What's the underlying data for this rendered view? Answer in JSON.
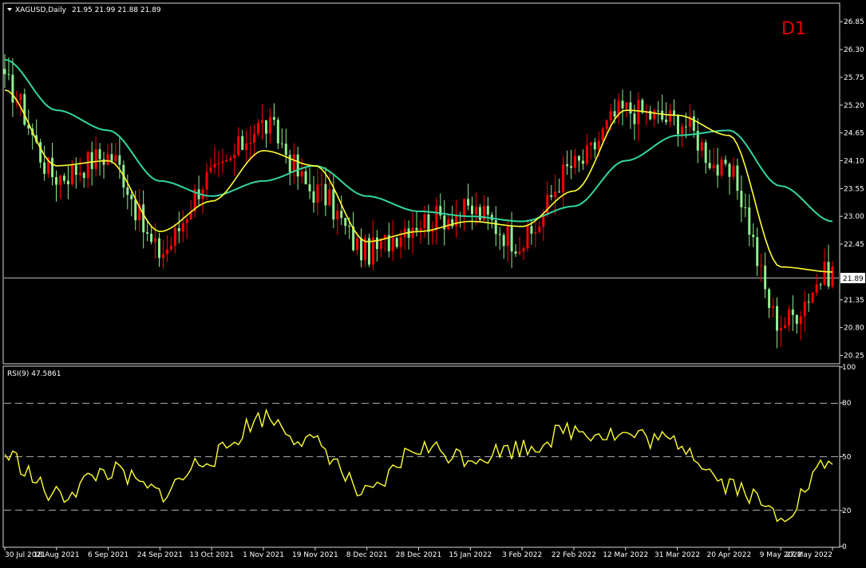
{
  "main_chart": {
    "symbol_info": "XAGUSD,Daily",
    "ohlc_readout": "21.95 21.99 21.88 21.89",
    "timeframe_badge": "D1",
    "current_price_label": "21.89",
    "price_ticks": [
      "26.85",
      "26.30",
      "25.75",
      "25.20",
      "24.65",
      "24.10",
      "23.55",
      "23.00",
      "22.45",
      "21.89",
      "21.35",
      "20.80",
      "20.25"
    ],
    "colors": {
      "bull": "#ff0000",
      "bear": "#90ee90",
      "fast_ma": "#ffff33",
      "slow_ma": "#33d6a0",
      "background": "#000000"
    }
  },
  "rsi_panel": {
    "title": "RSI(9) 47.5861",
    "ticks": [
      "100",
      "80",
      "50",
      "20",
      "0"
    ]
  },
  "x_axis_labels": [
    "30 Jul 2021",
    "18 Aug 2021",
    "6 Sep 2021",
    "24 Sep 2021",
    "13 Oct 2021",
    "1 Nov 2021",
    "19 Nov 2021",
    "8 Dec 2021",
    "28 Dec 2021",
    "15 Jan 2022",
    "3 Feb 2022",
    "22 Feb 2022",
    "12 Mar 2022",
    "31 Mar 2022",
    "20 Apr 2022",
    "9 May 2022",
    "27 May 2022"
  ],
  "chart_data": [
    {
      "type": "line",
      "title": "XAGUSD,Daily",
      "ylim": [
        20.1,
        27.2
      ],
      "x": [
        "30 Jul 2021",
        "18 Aug 2021",
        "6 Sep 2021",
        "24 Sep 2021",
        "13 Oct 2021",
        "1 Nov 2021",
        "19 Nov 2021",
        "8 Dec 2021",
        "28 Dec 2021",
        "15 Jan 2022",
        "3 Feb 2022",
        "22 Feb 2022",
        "12 Mar 2022",
        "31 Mar 2022",
        "20 Apr 2022",
        "9 May 2022",
        "27 May 2022"
      ],
      "series": [
        {
          "values": [
            25.6,
            23.8,
            24.2,
            22.3,
            23.8,
            24.8,
            23.5,
            22.3,
            22.9,
            23.1,
            22.5,
            24.0,
            25.1,
            24.9,
            23.8,
            20.9,
            21.9
          ]
        },
        {
          "values": [
            25.5,
            24.0,
            24.1,
            22.7,
            23.3,
            24.3,
            24.0,
            22.5,
            22.7,
            22.9,
            22.8,
            23.5,
            25.1,
            25.0,
            24.6,
            22.0,
            21.9
          ]
        },
        {
          "values": [
            26.1,
            25.1,
            24.7,
            23.7,
            23.4,
            23.7,
            24.0,
            23.4,
            23.1,
            23.0,
            22.9,
            23.2,
            24.1,
            24.6,
            24.7,
            23.6,
            22.9
          ]
        }
      ]
    },
    {
      "type": "line",
      "title": "RSI(9) 47.5861",
      "ylim": [
        0,
        100
      ],
      "x": [
        "30 Jul 2021",
        "18 Aug 2021",
        "6 Sep 2021",
        "24 Sep 2021",
        "13 Oct 2021",
        "1 Nov 2021",
        "19 Nov 2021",
        "8 Dec 2021",
        "28 Dec 2021",
        "15 Jan 2022",
        "3 Feb 2022",
        "22 Feb 2022",
        "12 Mar 2022",
        "31 Mar 2022",
        "20 Apr 2022",
        "9 May 2022",
        "27 May 2022"
      ],
      "series": [
        {
          "values": [
            51,
            28,
            42,
            30,
            50,
            72,
            57,
            28,
            55,
            50,
            55,
            65,
            62,
            58,
            35,
            18,
            47.6
          ]
        }
      ],
      "reference_levels": [
        80,
        50,
        20
      ]
    }
  ]
}
